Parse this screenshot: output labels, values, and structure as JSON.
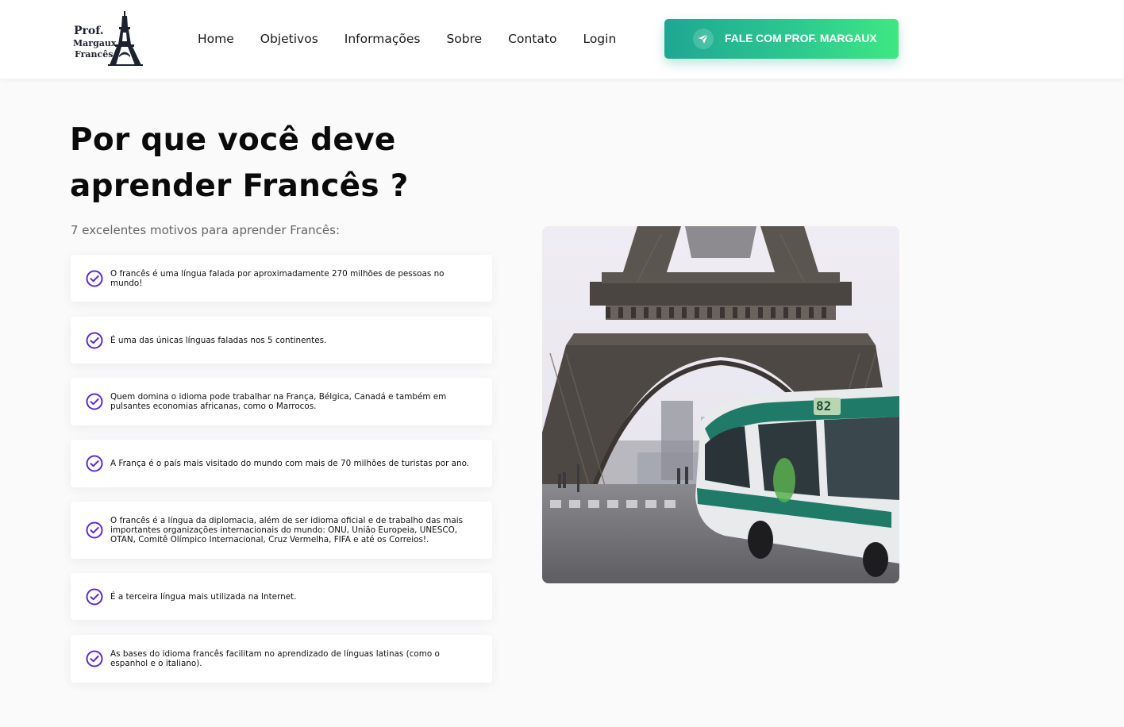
{
  "header": {
    "logo": {
      "line1": "Prof.",
      "line2": "Margaux",
      "line3": "Francês"
    },
    "nav": [
      {
        "label": "Home"
      },
      {
        "label": "Objetivos"
      },
      {
        "label": "Informações"
      },
      {
        "label": "Sobre"
      },
      {
        "label": "Contato"
      },
      {
        "label": "Login"
      }
    ],
    "cta": {
      "label": "FALE COM PROF. MARGAUX",
      "icon": "send-icon"
    }
  },
  "main": {
    "title_line1": "Por que você deve",
    "title_line2": "aprender Francês ?",
    "subtitle": "7 excelentes motivos para aprender Francês:",
    "reasons": [
      {
        "text": "O francês é uma língua falada por aproximadamente 270 milhões de pessoas no mundo!"
      },
      {
        "text": "É uma das únicas línguas faladas nos 5 continentes."
      },
      {
        "text": "Quem domina o idioma pode trabalhar na França, Bélgica, Canadá e também em pulsantes economias africanas, como o Marrocos."
      },
      {
        "text": "A França é o país mais visitado do mundo com mais de 70 milhões de turistas por ano."
      },
      {
        "text": "O francês é a língua da diplomacia, além de ser idioma oficial e de trabalho das mais importantes organizações internacionais do mundo: ONU, União Europeia, UNESCO, OTAN, Comitê Olímpico Internacional, Cruz Vermelha, FIFA e até os Correios!."
      },
      {
        "text": "É a terceira língua mais utilizada na Internet."
      },
      {
        "text": "As bases do idioma francês facilitam no aprendizado de línguas latinas (como o espanhol e o italiano)."
      }
    ],
    "photo": {
      "bus_number": "82"
    }
  },
  "colors": {
    "accent_purple": "#5b2bd6",
    "cta_gradient_start": "#1ea792",
    "cta_gradient_end": "#3ee882",
    "background": "#fafafb"
  }
}
